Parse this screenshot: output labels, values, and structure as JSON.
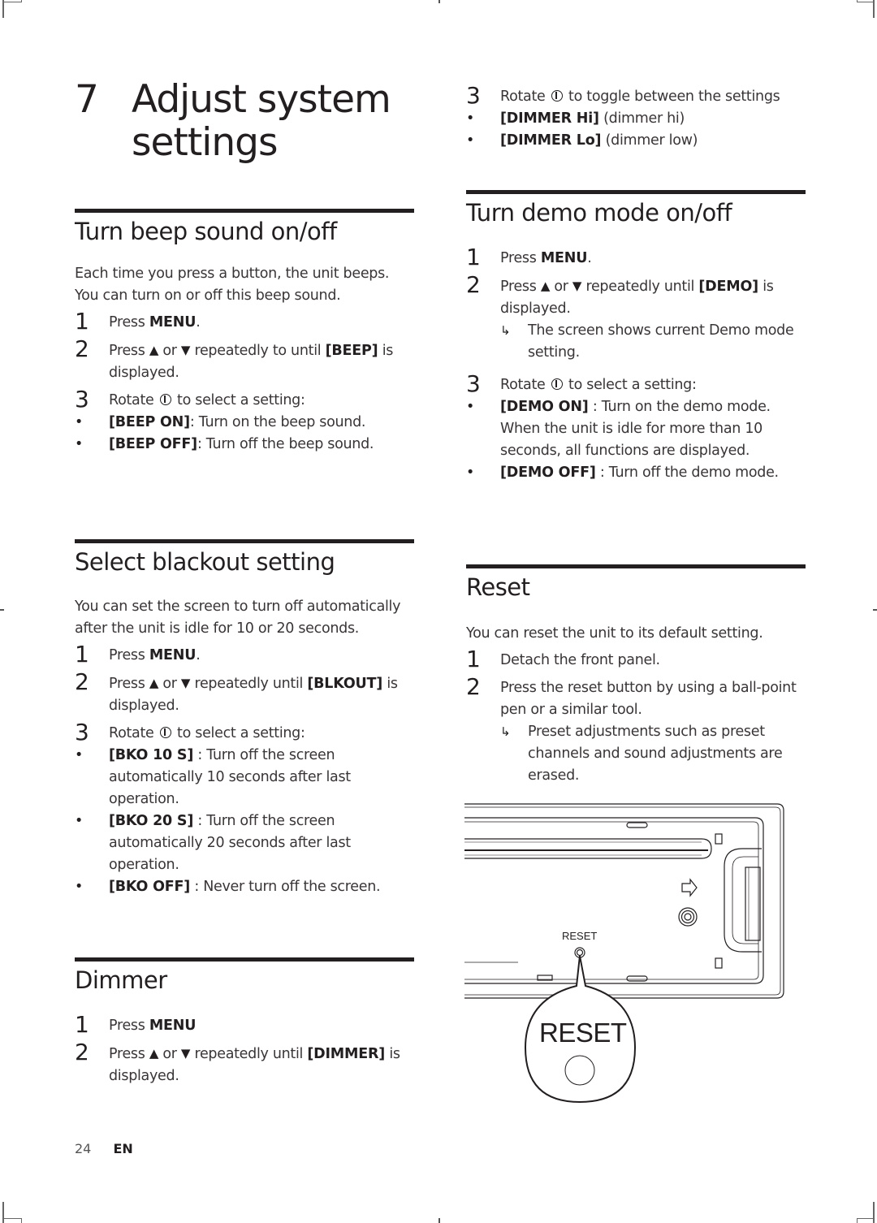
{
  "chapter": {
    "number": "7",
    "title_line1": "Adjust system",
    "title_line2": "settings"
  },
  "symbols": {
    "up_triangle": "▲",
    "down_triangle": "▼",
    "bullet": "•",
    "result_arrow": "↳",
    "rotate_knob_icon": "rotate-knob-icon"
  },
  "sections": {
    "beep": {
      "title": "Turn beep sound on/off",
      "intro": "Each time you press a button, the unit beeps. You can turn on or off this beep sound.",
      "steps": [
        {
          "num": "1",
          "pre": "Press ",
          "bold": "MENU",
          "post": "."
        },
        {
          "num": "2",
          "pre": "Press",
          "mid": "or",
          "post_a": "repeatedly to until ",
          "bold": "[BEEP]",
          "post_b": " is displayed."
        },
        {
          "num": "3",
          "pre": "Rotate",
          "post": "to select a setting:"
        }
      ],
      "options": [
        {
          "bold": "[BEEP ON]",
          "text": ": Turn on the beep sound."
        },
        {
          "bold": "[BEEP OFF]",
          "text": ": Turn off the beep sound."
        }
      ]
    },
    "blackout": {
      "title": "Select blackout setting",
      "intro": "You can set the screen to turn off automatically after the unit is idle for 10 or 20 seconds.",
      "steps": [
        {
          "num": "1",
          "pre": "Press ",
          "bold": "MENU",
          "post": "."
        },
        {
          "num": "2",
          "pre": "Press",
          "mid": "or",
          "post_a": "repeatedly until ",
          "bold": "[BLKOUT]",
          "post_b": " is displayed."
        },
        {
          "num": "3",
          "pre": "Rotate",
          "post": "to select a setting:"
        }
      ],
      "options": [
        {
          "bold": "[BKO 10 S]",
          "text": " : Turn off the screen automatically 10 seconds after last operation."
        },
        {
          "bold": "[BKO 20 S]",
          "text": " : Turn off the screen automatically 20 seconds after last operation."
        },
        {
          "bold": "[BKO OFF]",
          "text": " : Never turn off the screen."
        }
      ]
    },
    "dimmer": {
      "title": "Dimmer",
      "steps": [
        {
          "num": "1",
          "pre": "Press ",
          "bold": "MENU",
          "post": ""
        },
        {
          "num": "2",
          "pre": "Press",
          "mid": "or",
          "post_a": "repeatedly until ",
          "bold": "[DIMMER]",
          "post_b": " is displayed."
        },
        {
          "num": "3",
          "pre": "Rotate",
          "post": "to toggle between the settings"
        }
      ],
      "options": [
        {
          "bold": "[DIMMER Hi]",
          "text": " (dimmer hi)"
        },
        {
          "bold": "[DIMMER Lo]",
          "text": " (dimmer low)"
        }
      ]
    },
    "demo": {
      "title": "Turn demo mode on/off",
      "steps": [
        {
          "num": "1",
          "pre": "Press ",
          "bold": "MENU",
          "post": "."
        },
        {
          "num": "2",
          "pre": "Press",
          "mid": "or",
          "post_a": "repeatedly until ",
          "bold": "[DEMO]",
          "post_b": " is displayed."
        },
        {
          "num": "3",
          "pre": "Rotate",
          "post": "to select a setting:"
        }
      ],
      "step2_result": "The screen shows current Demo mode setting.",
      "options": [
        {
          "bold": "[DEMO ON]",
          "text": " : Turn on the demo mode. When the unit is idle for more than 10 seconds, all functions are displayed."
        },
        {
          "bold": "[DEMO OFF]",
          "text": " : Turn off the demo mode."
        }
      ]
    },
    "reset": {
      "title": "Reset",
      "intro": "You can reset the unit to its default setting.",
      "steps": [
        {
          "num": "1",
          "text": "Detach the front panel."
        },
        {
          "num": "2",
          "text": "Press the reset button by using a ball-point pen or a similar tool."
        }
      ],
      "step2_result": "Preset adjustments such as preset channels and sound adjustments are erased.",
      "diagram": {
        "small_label": "RESET",
        "callout_label": "RESET"
      }
    }
  },
  "footer": {
    "page_number": "24",
    "language": "EN"
  }
}
